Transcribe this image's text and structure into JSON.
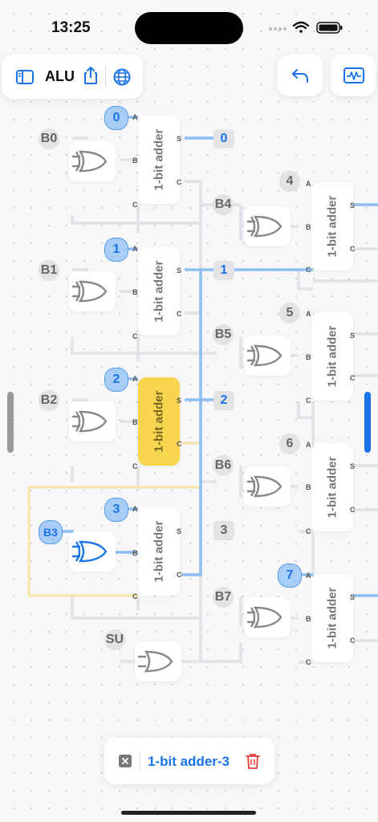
{
  "status": {
    "time": "13:25"
  },
  "toolbar": {
    "title": "ALU"
  },
  "inputs": {
    "b0": "B0",
    "b1": "B1",
    "b2": "B2",
    "b3": "B3",
    "b4": "B4",
    "b5": "B5",
    "b6": "B6",
    "b7": "B7",
    "su": "SU"
  },
  "a_inputs": [
    "0",
    "1",
    "2",
    "3",
    "4",
    "5",
    "6",
    "7"
  ],
  "outputs": [
    "0",
    "1",
    "2",
    "3"
  ],
  "adder_label": "1-bit adder",
  "pins": {
    "a": "A",
    "b": "B",
    "c": "C",
    "s": "S"
  },
  "selection": {
    "label": "1-bit adder-3"
  },
  "colors": {
    "accent": "#1a73e8",
    "selected": "#f7d54c",
    "wire_active": "#8fbdf0",
    "wire_idle": "#e2e2e6",
    "delete": "#e53935"
  }
}
